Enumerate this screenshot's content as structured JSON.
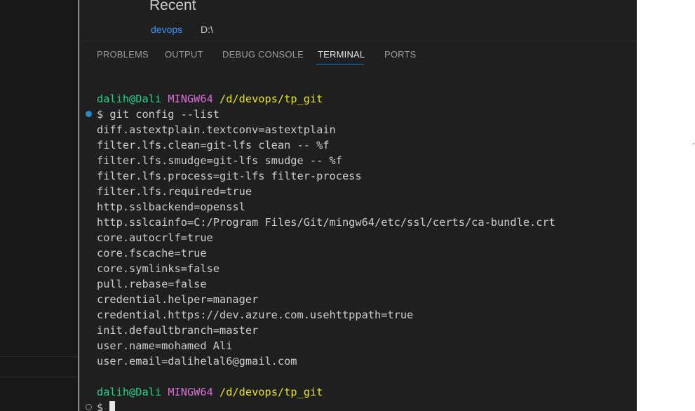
{
  "welcome": {
    "recent_title": "Recent",
    "recent_items": [
      {
        "name": "devops",
        "path": "D:\\"
      }
    ]
  },
  "panel": {
    "tabs": [
      {
        "label": "PROBLEMS",
        "active": false
      },
      {
        "label": "OUTPUT",
        "active": false
      },
      {
        "label": "DEBUG CONSOLE",
        "active": false
      },
      {
        "label": "TERMINAL",
        "active": true
      },
      {
        "label": "PORTS",
        "active": false
      }
    ]
  },
  "terminal": {
    "prompt": {
      "user_host": "dalih@Dali",
      "shell": "MINGW64",
      "cwd": "/d/devops/tp_git"
    },
    "command": "$ git config --list",
    "output_lines": [
      "diff.astextplain.textconv=astextplain",
      "filter.lfs.clean=git-lfs clean -- %f",
      "filter.lfs.smudge=git-lfs smudge -- %f",
      "filter.lfs.process=git-lfs filter-process",
      "filter.lfs.required=true",
      "http.sslbackend=openssl",
      "http.sslcainfo=C:/Program Files/Git/mingw64/etc/ssl/certs/ca-bundle.crt",
      "core.autocrlf=true",
      "core.fscache=true",
      "core.symlinks=false",
      "pull.rebase=false",
      "credential.helper=manager",
      "credential.https://dev.azure.com.usehttppath=true",
      "init.defaultbranch=master",
      "user.name=mohamed Ali",
      "user.email=dalihelal6@gmail.com"
    ],
    "next_prompt_symbol": "$ "
  },
  "colors": {
    "accent": "#0078d4",
    "prompt_user": "#23d18b",
    "prompt_shell": "#d670d6",
    "prompt_path": "#e5e510",
    "link": "#3794ff"
  }
}
